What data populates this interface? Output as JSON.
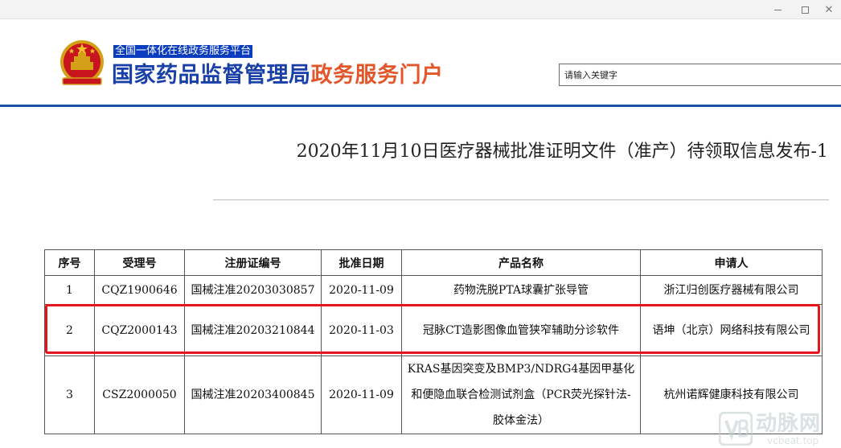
{
  "window": {
    "minimize_icon": "minimize-icon",
    "maximize_icon": "maximize-icon",
    "close_icon": "close-icon",
    "close_glyph": "✕"
  },
  "header": {
    "platform_label": "全国一体化在线政务服务平台",
    "title_main": "国家药品监督管理局",
    "title_portal": "政务服务门户",
    "search_value": "请输入关键字",
    "emblem_icon": "national-emblem-icon"
  },
  "article": {
    "title": "2020年11月10日医疗器械批准证明文件（准产）待领取信息发布-1"
  },
  "table": {
    "headers": [
      "序号",
      "受理号",
      "注册证编号",
      "批准日期",
      "产品名称",
      "申请人"
    ],
    "rows": [
      {
        "no": "1",
        "acceptance": "CQZ1900646",
        "registration": "国械注准20203030857",
        "date": "2020-11-09",
        "product": "药物洗脱PTA球囊扩张导管",
        "applicant": "浙江归创医疗器械有限公司"
      },
      {
        "no": "2",
        "acceptance": "CQZ2000143",
        "registration": "国械注准20203210844",
        "date": "2020-11-03",
        "product": "冠脉CT造影图像血管狭窄辅助分诊软件",
        "applicant": "语坤（北京）网络科技有限公司"
      },
      {
        "no": "3",
        "acceptance": "CSZ2000050",
        "registration": "国械注准20203400845",
        "date": "2020-11-09",
        "product": "KRAS基因突变及BMP3/NDRG4基因甲基化和便隐血联合检测试剂盒（PCR荧光探针法-胶体金法）",
        "applicant": "杭州诺辉健康科技有限公司"
      }
    ]
  },
  "highlight": {
    "row": 2,
    "color": "#e8141c"
  },
  "watermark": {
    "brand": "动脉网",
    "url": "vcbeat.top",
    "logo_icon": "vb-logo-icon"
  },
  "colors": {
    "accent_blue": "#1840a8",
    "accent_orange": "#e2562a",
    "platform_bg": "#0a3cbf",
    "header_rule": "#1a4fa8"
  }
}
